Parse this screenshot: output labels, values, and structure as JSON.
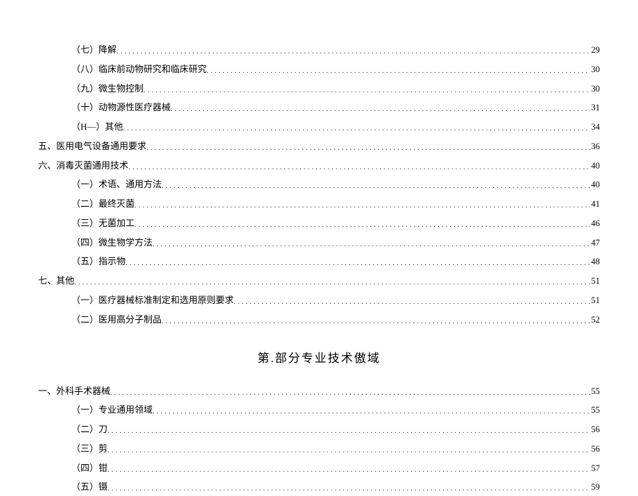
{
  "toc_part1": [
    {
      "indent": 2,
      "label": "（七）降解",
      "page": "29"
    },
    {
      "indent": 2,
      "label": "（八）临床前动物研究和临床研究",
      "page": "30"
    },
    {
      "indent": 2,
      "label": "（九）微生物控制",
      "page": "30"
    },
    {
      "indent": 2,
      "label": "（十）动物源性医疗器械",
      "page": "31"
    },
    {
      "indent": 2,
      "label": "（H—）其他",
      "page": "34"
    },
    {
      "indent": 1,
      "label": "五、医用电气设备通用要求",
      "page": "36"
    },
    {
      "indent": 1,
      "label": "六、消毒灭菌通用技术",
      "page": "40"
    },
    {
      "indent": 2,
      "label": "（一）术语、通用方法",
      "page": "40"
    },
    {
      "indent": 2,
      "label": "（二）最终灭菌",
      "page": "41"
    },
    {
      "indent": 2,
      "label": "（三）无菌加工",
      "page": "46"
    },
    {
      "indent": 2,
      "label": "（四）微生物学方法",
      "page": "47"
    },
    {
      "indent": 2,
      "label": "（五）指示物",
      "page": "48"
    },
    {
      "indent": 1,
      "label": "七、其他",
      "page": "51"
    },
    {
      "indent": 2,
      "label": "（一）医疗器械标准制定和选用原则要求",
      "page": "51"
    },
    {
      "indent": 2,
      "label": "（二）医用高分子制品",
      "page": "52"
    }
  ],
  "section_heading": "第.部分专业技术傲域",
  "toc_part2": [
    {
      "indent": 1,
      "label": "一、外科手术器械",
      "page": "55"
    },
    {
      "indent": 2,
      "label": "（一）专业通用领域",
      "page": "55"
    },
    {
      "indent": 2,
      "label": "（二）刀",
      "page": "56"
    },
    {
      "indent": 2,
      "label": "（三）剪",
      "page": "56"
    },
    {
      "indent": 2,
      "label": "（四）钳",
      "page": "57"
    },
    {
      "indent": 2,
      "label": "（五）镊",
      "page": "59"
    }
  ]
}
